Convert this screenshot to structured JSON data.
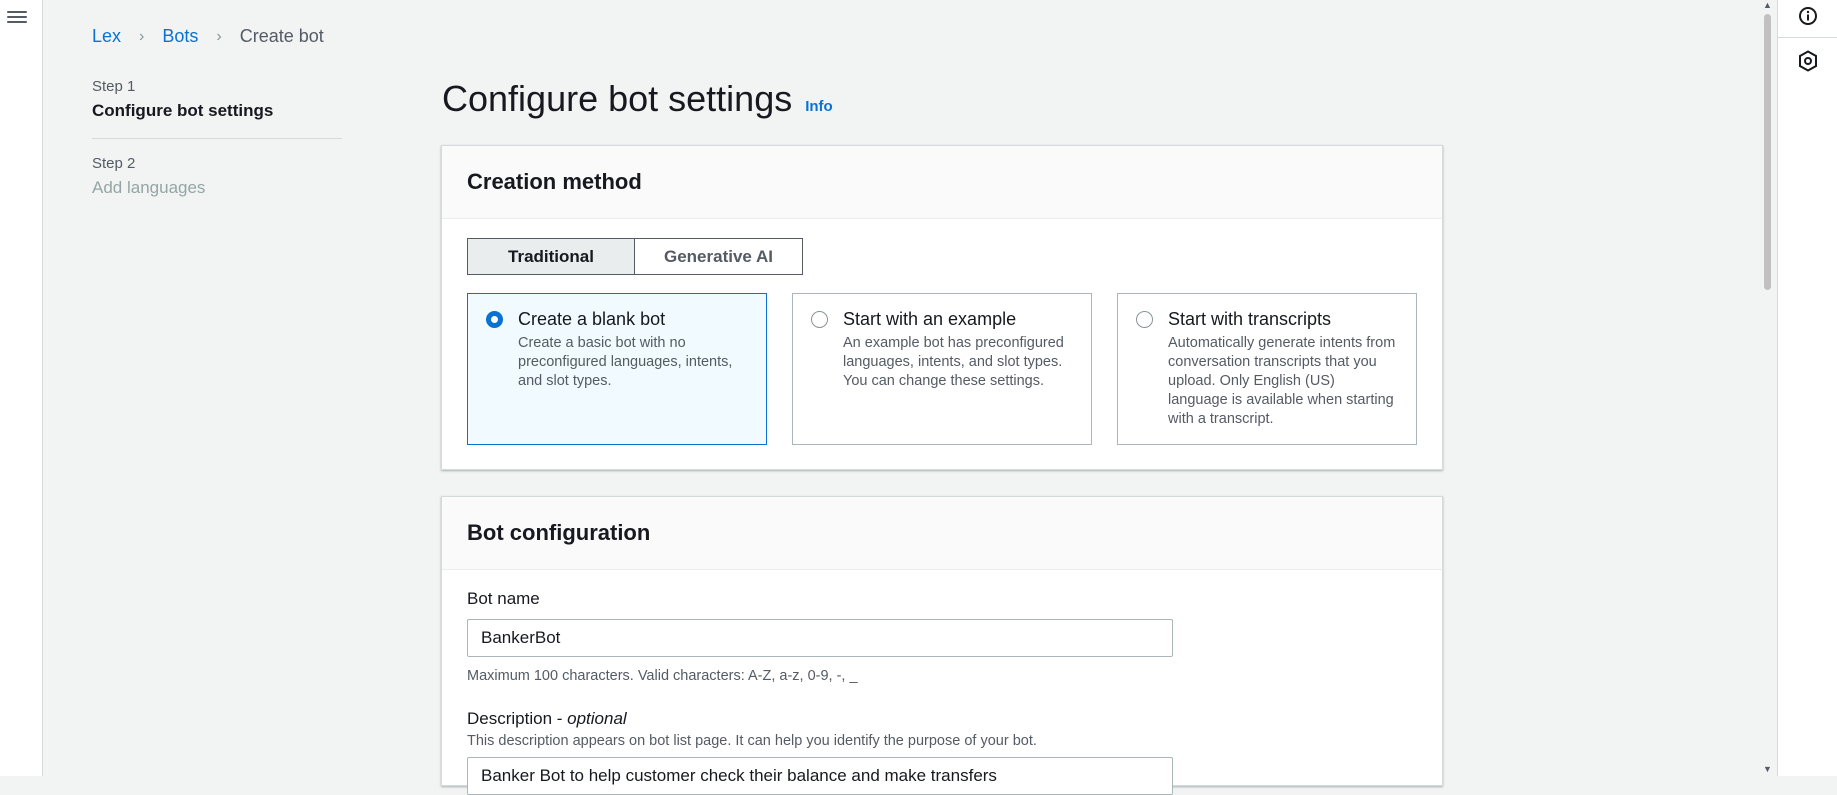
{
  "breadcrumb": {
    "items": [
      "Lex",
      "Bots"
    ],
    "current": "Create bot",
    "separator": "›"
  },
  "steps": [
    {
      "label": "Step 1",
      "title": "Configure bot settings"
    },
    {
      "label": "Step 2",
      "title": "Add languages"
    }
  ],
  "page": {
    "title": "Configure bot settings",
    "info": "Info"
  },
  "creation": {
    "header": "Creation method",
    "tabs": [
      "Traditional",
      "Generative AI"
    ],
    "options": [
      {
        "title": "Create a blank bot",
        "desc": "Create a basic bot with no preconfigured languages, intents, and slot types."
      },
      {
        "title": "Start with an example",
        "desc": "An example bot has preconfigured languages, intents, and slot types. You can change these settings."
      },
      {
        "title": "Start with transcripts",
        "desc": "Automatically generate intents from conversation transcripts that you upload. Only English (US) language is available when starting with a transcript."
      }
    ]
  },
  "config": {
    "header": "Bot configuration",
    "name_label": "Bot name",
    "name_value": "BankerBot",
    "name_hint": "Maximum 100 characters. Valid characters: A-Z, a-z, 0-9, -, _",
    "desc_label": "Description - ",
    "desc_optional": "optional",
    "desc_hint": "This description appears on bot list page. It can help you identify the purpose of your bot.",
    "desc_value": "Banker Bot to help customer check their balance and make transfers"
  },
  "colors": {
    "accent": "#0972d3",
    "page_bg": "#f2f3f3",
    "selected_tile_bg": "#f1faff"
  }
}
